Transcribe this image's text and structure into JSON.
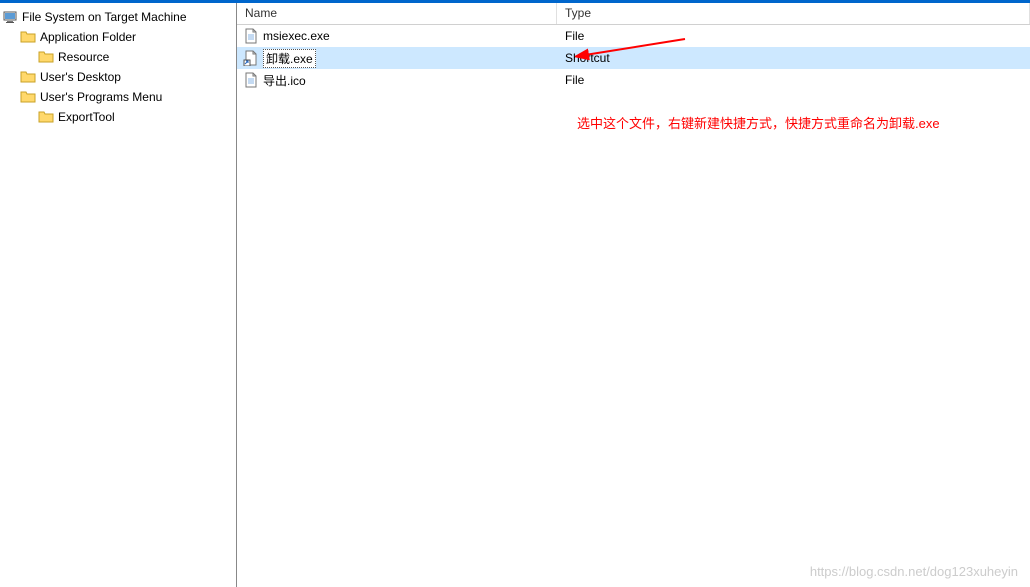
{
  "tree": {
    "root": "File System on Target Machine",
    "items": [
      {
        "label": "Application Folder",
        "indent": 1
      },
      {
        "label": "Resource",
        "indent": 2
      },
      {
        "label": "User's Desktop",
        "indent": 1
      },
      {
        "label": "User's Programs Menu",
        "indent": 1
      },
      {
        "label": "ExportTool",
        "indent": 2
      }
    ]
  },
  "list": {
    "columns": {
      "name": "Name",
      "type": "Type"
    },
    "rows": [
      {
        "name": "msiexec.exe",
        "type": "File",
        "icon": "file",
        "selected": false
      },
      {
        "name": "卸载.exe",
        "type": "Shortcut",
        "icon": "shortcut",
        "selected": true,
        "editing": true
      },
      {
        "name": "导出.ico",
        "type": "File",
        "icon": "file",
        "selected": false
      }
    ]
  },
  "annotation": {
    "text": "选中这个文件，右键新建快捷方式，快捷方式重命名为卸载.exe"
  },
  "watermark": "https://blog.csdn.net/dog123xuheyin"
}
